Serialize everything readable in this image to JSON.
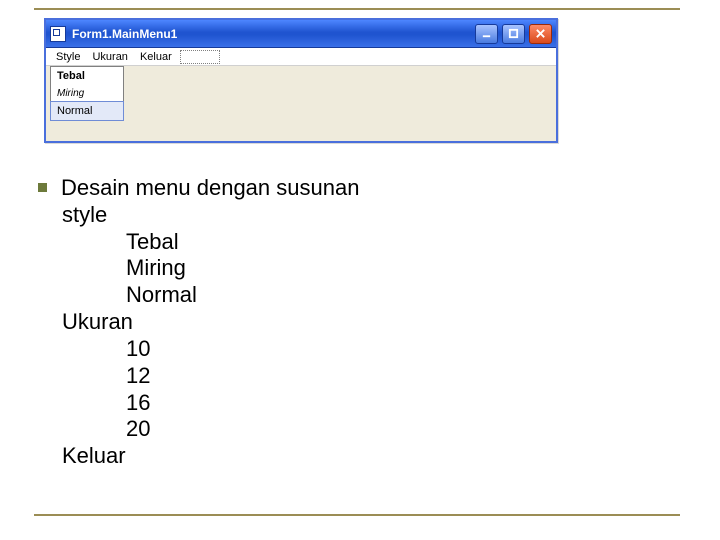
{
  "window": {
    "title": "Form1.MainMenu1",
    "icon_name": "app-form-icon"
  },
  "menubar": {
    "items": [
      {
        "label": "Style"
      },
      {
        "label": "Ukuran"
      },
      {
        "label": "Keluar"
      }
    ]
  },
  "dropdown": {
    "items": [
      {
        "label": "Tebal",
        "style": "tebal",
        "selected": false
      },
      {
        "label": "Miring",
        "style": "miring",
        "selected": false
      },
      {
        "label": "Normal",
        "style": "normal",
        "selected": true
      }
    ]
  },
  "slide": {
    "bullet_heading": "Desain menu dengan susunan",
    "groups": [
      {
        "label": "style",
        "items": [
          "Tebal",
          "Miring",
          "Normal"
        ]
      },
      {
        "label": "Ukuran",
        "items": [
          "10",
          "12",
          "16",
          "20"
        ]
      },
      {
        "label": "Keluar",
        "items": []
      }
    ]
  }
}
